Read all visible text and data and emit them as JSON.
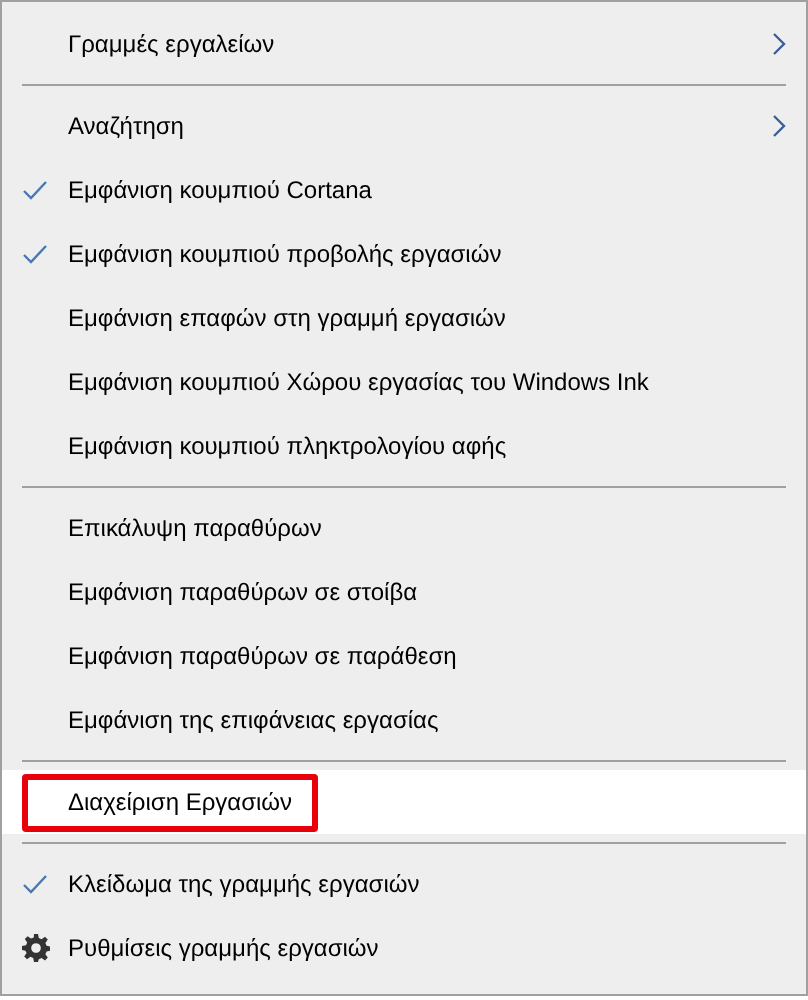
{
  "menu": {
    "items": [
      {
        "kind": "item",
        "label": "Γραμμές εργαλείων",
        "checked": false,
        "submenu": true,
        "hovered": false,
        "outlined": false
      },
      {
        "kind": "separator"
      },
      {
        "kind": "item",
        "label": "Αναζήτηση",
        "checked": false,
        "submenu": true,
        "hovered": false,
        "outlined": false
      },
      {
        "kind": "item",
        "label": "Εμφάνιση κουμπιού Cortana",
        "checked": true,
        "submenu": false,
        "hovered": false,
        "outlined": false
      },
      {
        "kind": "item",
        "label": "Εμφάνιση κουμπιού προβολής εργασιών",
        "checked": true,
        "submenu": false,
        "hovered": false,
        "outlined": false
      },
      {
        "kind": "item",
        "label": "Εμφάνιση επαφών στη γραμμή εργασιών",
        "checked": false,
        "submenu": false,
        "hovered": false,
        "outlined": false
      },
      {
        "kind": "item",
        "label": "Εμφάνιση κουμπιού Χώρου εργασίας του Windows Ink",
        "checked": false,
        "submenu": false,
        "hovered": false,
        "outlined": false
      },
      {
        "kind": "item",
        "label": "Εμφάνιση κουμπιού πληκτρολογίου αφής",
        "checked": false,
        "submenu": false,
        "hovered": false,
        "outlined": false
      },
      {
        "kind": "separator"
      },
      {
        "kind": "item",
        "label": "Επικάλυψη παραθύρων",
        "checked": false,
        "submenu": false,
        "hovered": false,
        "outlined": false
      },
      {
        "kind": "item",
        "label": "Εμφάνιση παραθύρων σε στοίβα",
        "checked": false,
        "submenu": false,
        "hovered": false,
        "outlined": false
      },
      {
        "kind": "item",
        "label": "Εμφάνιση παραθύρων σε παράθεση",
        "checked": false,
        "submenu": false,
        "hovered": false,
        "outlined": false
      },
      {
        "kind": "item",
        "label": "Εμφάνιση της επιφάνειας εργασίας",
        "checked": false,
        "submenu": false,
        "hovered": false,
        "outlined": false
      },
      {
        "kind": "separator"
      },
      {
        "kind": "item",
        "label": "Διαχείριση Εργασιών",
        "checked": false,
        "submenu": false,
        "hovered": true,
        "outlined": true
      },
      {
        "kind": "separator"
      },
      {
        "kind": "item",
        "label": "Κλείδωμα της γραμμής εργασιών",
        "checked": true,
        "submenu": false,
        "hovered": false,
        "outlined": false
      },
      {
        "kind": "settings",
        "label": "Ρυθμίσεις γραμμής εργασιών",
        "checked": false,
        "submenu": false,
        "hovered": false,
        "outlined": false
      }
    ]
  }
}
